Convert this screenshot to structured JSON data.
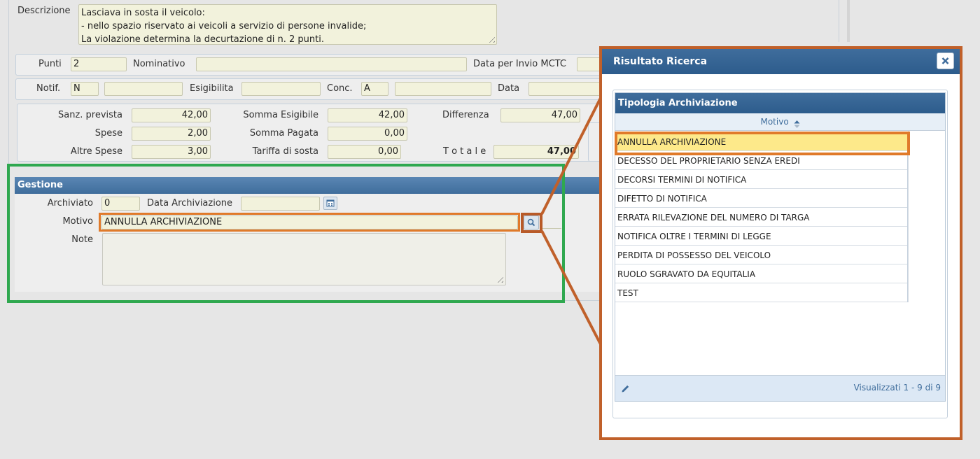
{
  "form": {
    "descrizione": {
      "label": "Descrizione",
      "lines": [
        "Lasciava in sosta il veicolo:",
        "- nello spazio riservato ai veicoli a servizio di persone invalide;",
        "La violazione determina la decurtazione di n. 2 punti."
      ]
    },
    "row_punti": {
      "punti_label": "Punti",
      "punti_value": "2",
      "nominativo_label": "Nominativo",
      "nominativo_value": "",
      "data_invio_label": "Data per Invio MCTC"
    },
    "row_notif": {
      "notif_label": "Notif.",
      "notif_value": "N",
      "esigibilita_label": "Esigibilita",
      "esigibilita_value": "",
      "conc_label": "Conc.",
      "conc_value": "A",
      "data_label": "Data"
    },
    "importi": {
      "sanz_prevista_label": "Sanz. prevista",
      "sanz_prevista": "42,00",
      "spese_label": "Spese",
      "spese": "2,00",
      "altre_spese_label": "Altre Spese",
      "altre_spese": "3,00",
      "somma_esigibile_label": "Somma Esigibile",
      "somma_esigibile": "42,00",
      "somma_pagata_label": "Somma Pagata",
      "somma_pagata": "0,00",
      "tariffa_sosta_label": "Tariffa di sosta",
      "tariffa_sosta": "0,00",
      "differenza_label": "Differenza",
      "differenza": "47,00",
      "totale_label": "T o t a l e",
      "totale": "47,00"
    }
  },
  "gestione": {
    "title": "Gestione",
    "archiviato_label": "Archiviato",
    "archiviato_value": "0",
    "data_archiviazione_label": "Data Archiviazione",
    "data_archiviazione_value": "",
    "motivo_label": "Motivo",
    "motivo_value": "ANNULLA ARCHIVIAZIONE",
    "note_label": "Note",
    "note_value": ""
  },
  "dialog": {
    "title": "Risultato Ricerca",
    "grid_title": "Tipologia Archiviazione",
    "column_header": "Motivo",
    "rows": [
      "ANNULLA ARCHIVIAZIONE",
      "DECESSO DEL PROPRIETARIO SENZA EREDI",
      "DECORSI TERMINI DI NOTIFICA",
      "DIFETTO DI NOTIFICA",
      "ERRATA RILEVAZIONE DEL NUMERO DI TARGA",
      "NOTIFICA OLTRE I TERMINI DI LEGGE",
      "PERDITA DI POSSESSO DEL VEICOLO",
      "RUOLO SGRAVATO DA EQUITALIA",
      "TEST"
    ],
    "selected_index": 0,
    "pager_text": "Visualizzati 1 - 9 di 9"
  },
  "icons": {
    "calendar": "calendar-icon",
    "search": "search-icon",
    "close": "close-icon",
    "edit": "pencil-icon",
    "sort": "sort-icon"
  },
  "colors": {
    "header_blue": "#3f6d9c",
    "annotation_orange": "#e07a2a",
    "annotation_dark_orange": "#c0602a",
    "annotation_green": "#2fa84f",
    "selected_row": "#fde98a",
    "field_bg": "#f2f2dc"
  }
}
